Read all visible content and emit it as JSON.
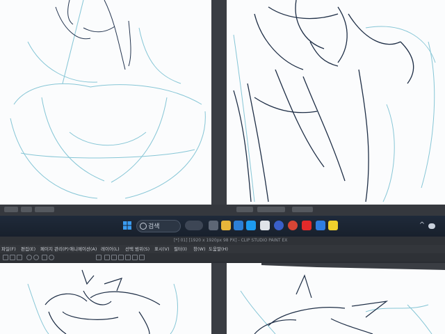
{
  "taskbar": {
    "search_placeholder": "검색",
    "icons": [
      "windows-start-icon",
      "search-icon",
      "widgets-icon",
      "task-view-icon",
      "file-explorer-icon",
      "browser-icon",
      "twitter-icon",
      "app-icon",
      "app-icon",
      "chrome-icon",
      "youtube-icon",
      "app-icon",
      "app-icon",
      "clip-studio-icon"
    ]
  },
  "app": {
    "title": "[*] 01] [1920 x 1920px 98 PX] - CLIP STUDIO PAINT EX",
    "menu": [
      "파일(F)",
      "편집(E)",
      "페이지 관리(P)",
      "애니메이션(A)",
      "레이어(L)",
      "선택 범위(S)",
      "표시(V)",
      "필터(I)",
      "창(W)",
      "도움말(H)"
    ]
  },
  "colors": {
    "sketch_blue": "#86c6d6",
    "line_dark": "#23344f",
    "taskbar": "#1c2533",
    "ui_dark": "#2e3136"
  }
}
